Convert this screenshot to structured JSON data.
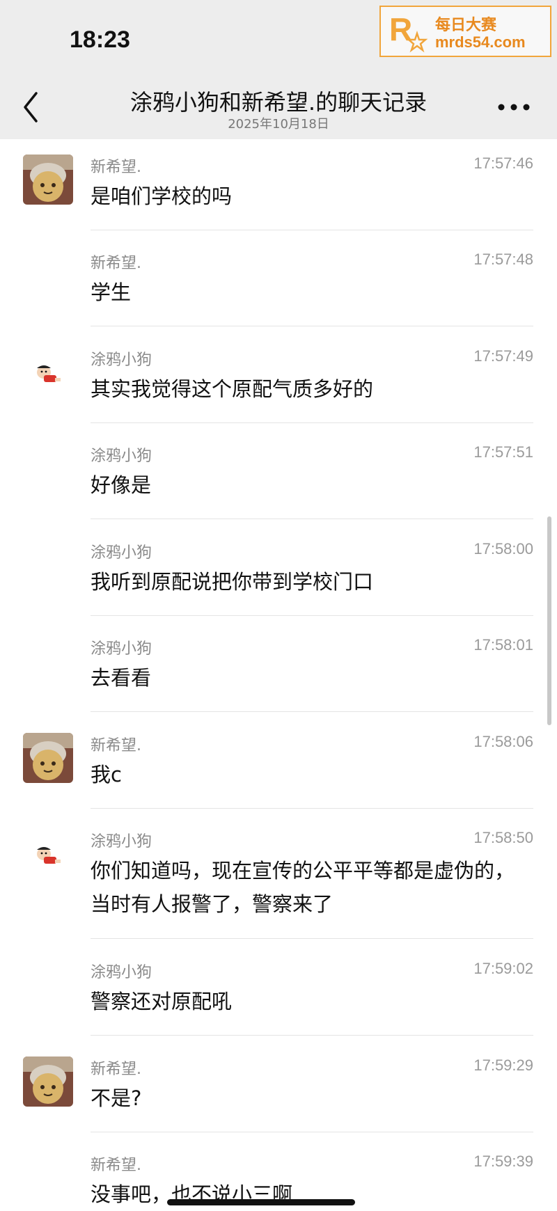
{
  "status_bar": {
    "time": "18:23"
  },
  "header": {
    "title": "涂鸦小狗和新希望.的聊天记录",
    "date": "2025年10月18日",
    "back_icon": "chevron-left-icon",
    "more_icon": "more-dots-icon"
  },
  "watermark": {
    "line1": "每日大赛",
    "line2": "mrds54.com"
  },
  "messages": [
    {
      "sender": "新希望.",
      "time": "17:57:46",
      "text": "是咱们学校的吗"
    },
    {
      "sender": "新希望.",
      "time": "17:57:48",
      "text": "学生"
    },
    {
      "sender": "涂鸦小狗",
      "time": "17:57:49",
      "text": "其实我觉得这个原配气质多好的"
    },
    {
      "sender": "涂鸦小狗",
      "time": "17:57:51",
      "text": "好像是"
    },
    {
      "sender": "涂鸦小狗",
      "time": "17:58:00",
      "text": "我听到原配说把你带到学校门口"
    },
    {
      "sender": "涂鸦小狗",
      "time": "17:58:01",
      "text": "去看看"
    },
    {
      "sender": "新希望.",
      "time": "17:58:06",
      "text": "我c"
    },
    {
      "sender": "涂鸦小狗",
      "time": "17:58:50",
      "text": "你们知道吗，现在宣传的公平平等都是虚伪的，当时有人报警了，警察来了"
    },
    {
      "sender": "涂鸦小狗",
      "time": "17:59:02",
      "text": "警察还对原配吼"
    },
    {
      "sender": "新希望.",
      "time": "17:59:29",
      "text": "不是?"
    },
    {
      "sender": "新希望.",
      "time": "17:59:39",
      "text": "没事吧，",
      "struck_text": "也不说小三啊"
    }
  ],
  "colors": {
    "header_bg": "#ededed",
    "watermark": "#e8891e"
  }
}
